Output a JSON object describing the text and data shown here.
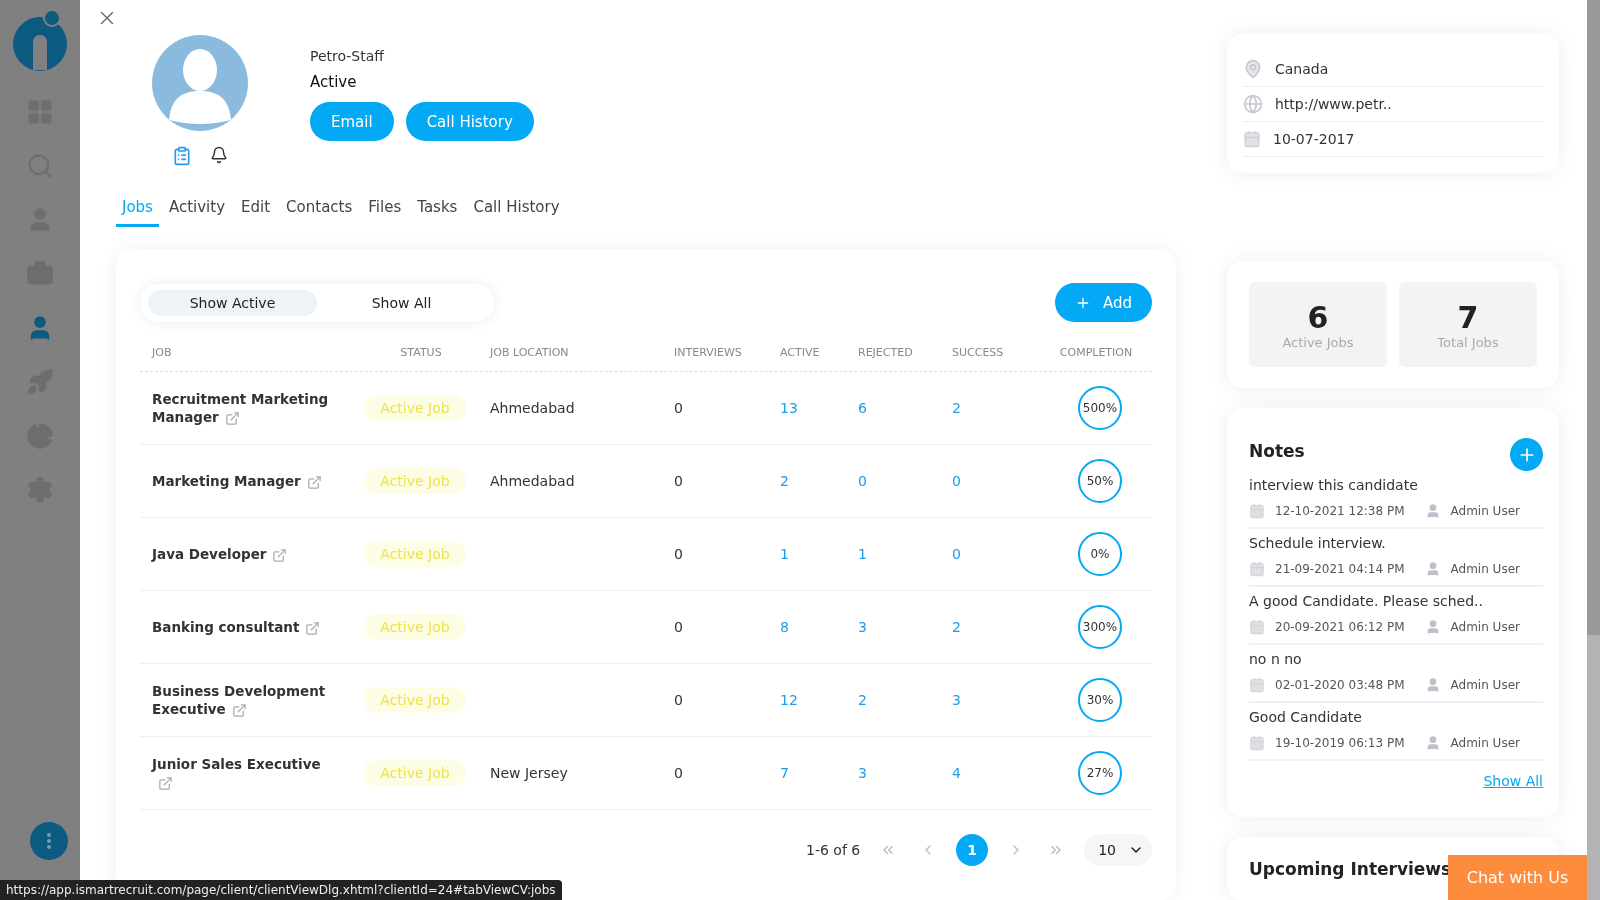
{
  "sidebar": {
    "items": [
      {
        "kind": "dashboard",
        "selected": false
      },
      {
        "kind": "search",
        "selected": false
      },
      {
        "kind": "person",
        "selected": false
      },
      {
        "kind": "briefcase",
        "selected": false
      },
      {
        "kind": "staff",
        "selected": true
      },
      {
        "kind": "rocket",
        "selected": false
      },
      {
        "kind": "chart",
        "selected": false
      },
      {
        "kind": "settings",
        "selected": false
      }
    ]
  },
  "profile": {
    "name": "Petro-Staff",
    "status": "Active",
    "buttons": [
      "Email",
      "Call History"
    ]
  },
  "tabs": [
    {
      "label": "Jobs",
      "selected": true
    },
    {
      "label": "Activity",
      "selected": false
    },
    {
      "label": "Edit",
      "selected": false
    },
    {
      "label": "Contacts",
      "selected": false
    },
    {
      "label": "Files",
      "selected": false
    },
    {
      "label": "Tasks",
      "selected": false
    },
    {
      "label": "Call History",
      "selected": false
    }
  ],
  "jobs_panel": {
    "filters": [
      {
        "label": "Show Active",
        "selected": true
      },
      {
        "label": "Show All",
        "selected": false
      }
    ],
    "add_button": "Add",
    "columns": [
      "JOB",
      "STATUS",
      "JOB LOCATION",
      "INTERVIEWS",
      "ACTIVE",
      "REJECTED",
      "SUCCESS",
      "COMPLETION"
    ],
    "rows": [
      {
        "job": "Recruitment Marketing Manager",
        "status": "Active Job",
        "location": "Ahmedabad",
        "interviews": "0",
        "active": "13",
        "rejected": "6",
        "success": "2",
        "completion": "500%"
      },
      {
        "job": "Marketing Manager",
        "status": "Active Job",
        "location": "Ahmedabad",
        "interviews": "0",
        "active": "2",
        "rejected": "0",
        "success": "0",
        "completion": "50%"
      },
      {
        "job": "Java Developer",
        "status": "Active Job",
        "interviews": "0",
        "active": "1",
        "rejected": "1",
        "success": "0",
        "completion": "0%"
      },
      {
        "job": "Banking consultant",
        "status": "Active Job",
        "interviews": "0",
        "active": "8",
        "rejected": "3",
        "success": "2",
        "completion": "300%"
      },
      {
        "job": "Business Development Executive",
        "status": "Active Job",
        "interviews": "0",
        "active": "12",
        "rejected": "2",
        "success": "3",
        "completion": "30%"
      },
      {
        "job": "Junior Sales Executive",
        "status": "Active Job",
        "location": "New Jersey",
        "interviews": "0",
        "active": "7",
        "rejected": "3",
        "success": "4",
        "completion": "27%"
      }
    ],
    "pagination": {
      "range": "1-6 of 6",
      "pages": [
        {
          "label": "1",
          "selected": true
        }
      ],
      "page_size": "10"
    }
  },
  "details": [
    {
      "kind": "location",
      "text": "Canada"
    },
    {
      "kind": "website",
      "text": "http://www.petr.."
    },
    {
      "kind": "date",
      "text": "10-07-2017"
    }
  ],
  "stats": [
    {
      "value": "6",
      "label": "Active Jobs"
    },
    {
      "value": "7",
      "label": "Total Jobs"
    }
  ],
  "notes": {
    "title": "Notes",
    "items": [
      {
        "text": "interview this candidate",
        "date": "12-10-2021 12:38 PM",
        "author": "Admin User"
      },
      {
        "text": "Schedule interview.",
        "date": "21-09-2021 04:14 PM",
        "author": "Admin User"
      },
      {
        "text": "A good Candidate. Please sched..",
        "date": "20-09-2021 06:12 PM",
        "author": "Admin User"
      },
      {
        "text": "no n no",
        "date": "02-01-2020 03:48 PM",
        "author": "Admin User"
      },
      {
        "text": "Good Candidate",
        "date": "19-10-2019 06:13 PM",
        "author": "Admin User"
      }
    ],
    "show_all": "Show All"
  },
  "upcoming": {
    "title": "Upcoming Interviews"
  },
  "chat_button": "Chat with Us",
  "status_url": "https://app.ismartrecruit.com/page/client/clientViewDlg.xhtml?clientId=24#tabViewCV:jobs"
}
